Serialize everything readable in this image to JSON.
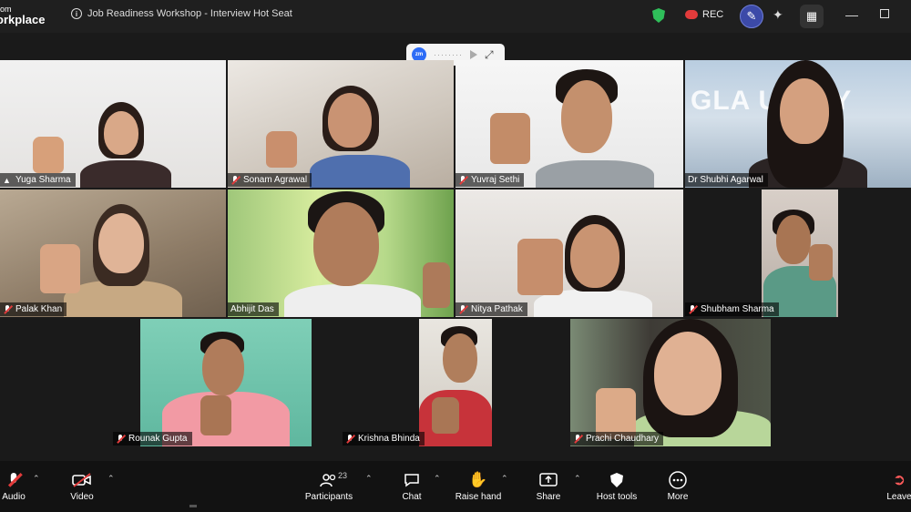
{
  "app": {
    "brand_line1": "om",
    "brand_line2": "orkplace",
    "meeting_title": "Job Readiness Workshop - Interview Hot Seat",
    "rec_label": "REC",
    "colors": {
      "active_speaker": "#3ddc84",
      "shield": "#2fbf5a",
      "rec": "#e23b3b",
      "leave": "#ff5b5b"
    }
  },
  "viewbar": {
    "logo": "zm",
    "dots": "········"
  },
  "participants": [
    {
      "name": "Yuga Sharma",
      "mic": "speaking"
    },
    {
      "name": "Sonam Agrawal",
      "mic": "muted"
    },
    {
      "name": "Yuvraj Sethi",
      "mic": "muted"
    },
    {
      "name": "Dr Shubhi Agarwal",
      "mic": "muted",
      "bg_text": "GLA U   SITY"
    },
    {
      "name": "Palak Khan",
      "mic": "muted"
    },
    {
      "name": "Abhijit Das",
      "mic": "on"
    },
    {
      "name": "Nitya Pathak",
      "mic": "muted"
    },
    {
      "name": "Shubham Sharma",
      "mic": "muted"
    },
    {
      "name": "Rounak Gupta",
      "mic": "muted"
    },
    {
      "name": "Krishna Bhinda",
      "mic": "muted"
    },
    {
      "name": "Prachi Chaudhary",
      "mic": "muted"
    }
  ],
  "toolbar": {
    "audio": "Audio",
    "video": "Video",
    "participants": "Participants",
    "participants_count": "23",
    "chat": "Chat",
    "raise_hand": "Raise hand",
    "share": "Share",
    "host_tools": "Host tools",
    "more": "More",
    "leave": "Leave"
  }
}
